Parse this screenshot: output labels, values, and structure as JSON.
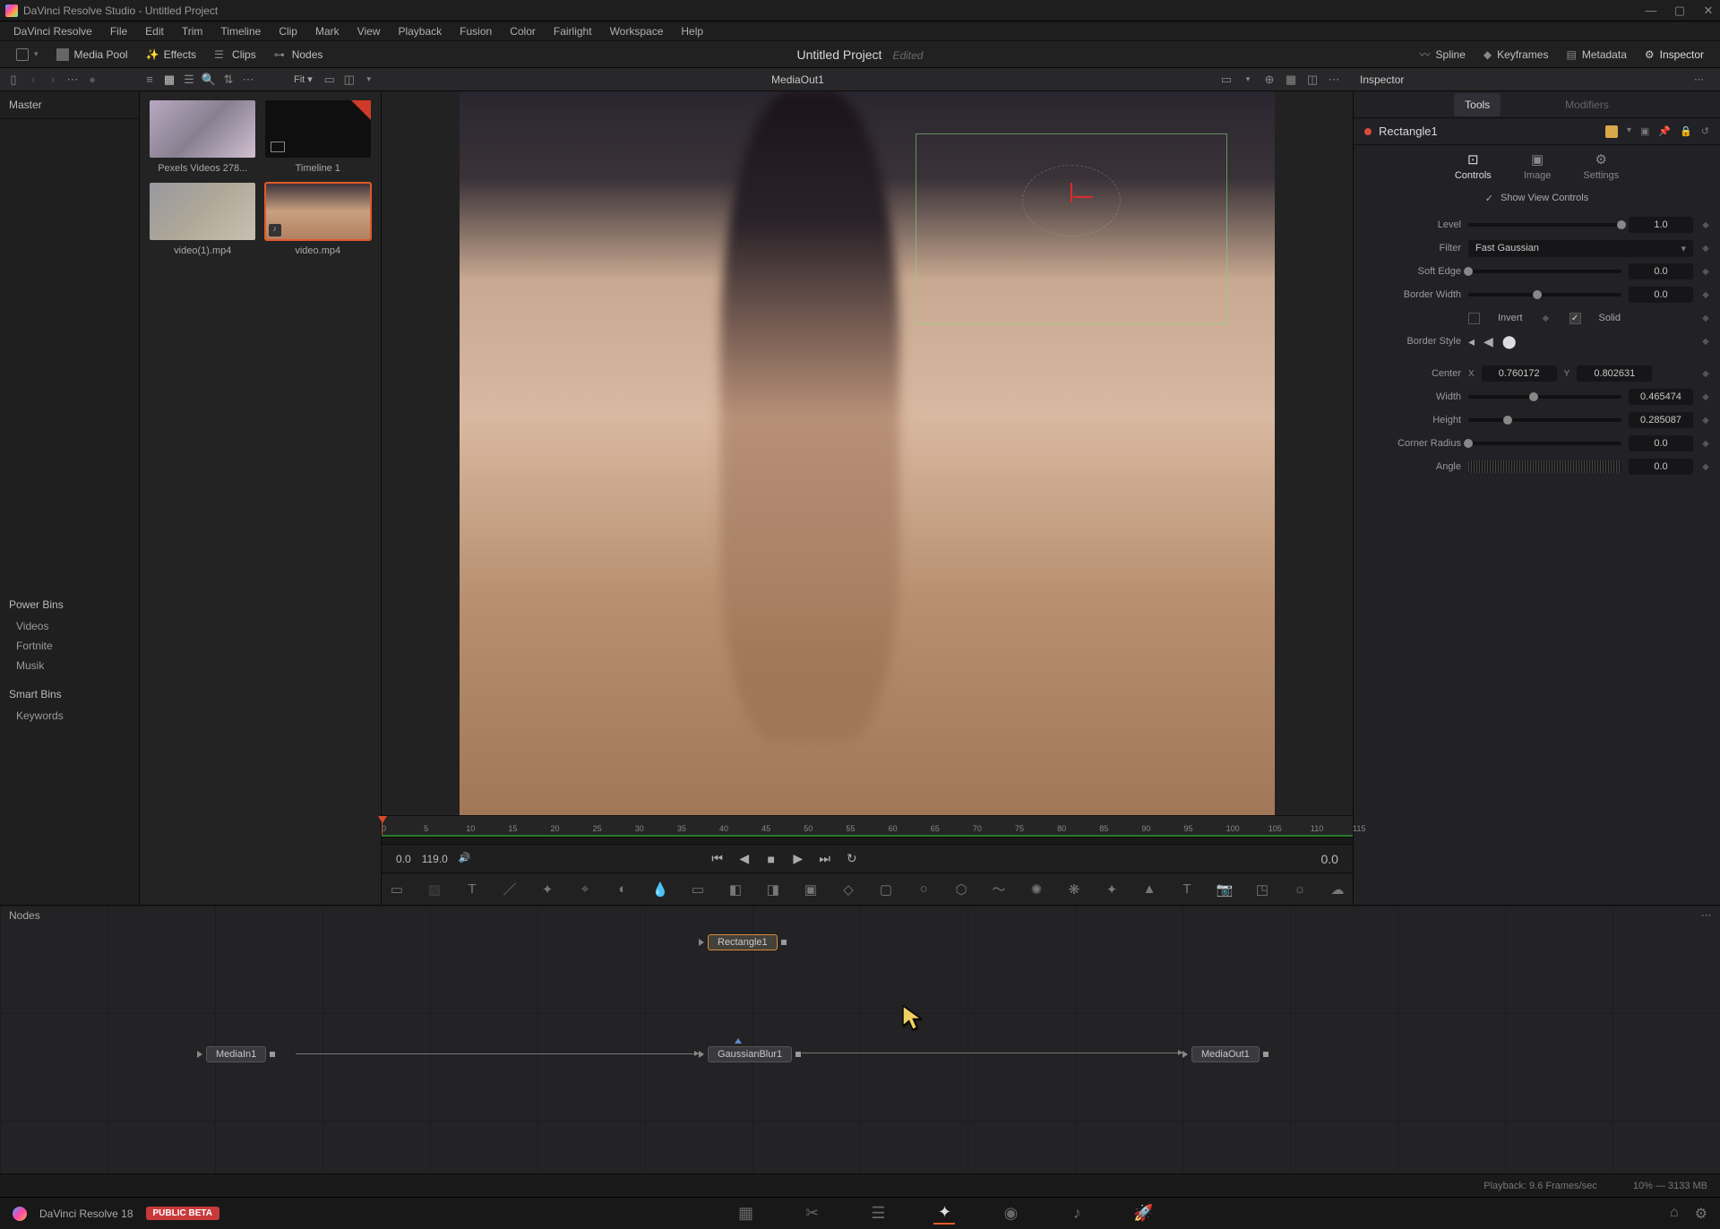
{
  "titlebar": {
    "text": "DaVinci Resolve Studio - Untitled Project"
  },
  "menu": [
    "DaVinci Resolve",
    "File",
    "Edit",
    "Trim",
    "Timeline",
    "Clip",
    "Mark",
    "View",
    "Playback",
    "Fusion",
    "Color",
    "Fairlight",
    "Workspace",
    "Help"
  ],
  "toolbar": {
    "media_pool": "Media Pool",
    "effects": "Effects",
    "clips": "Clips",
    "nodes": "Nodes",
    "project": "Untitled Project",
    "edited": "Edited",
    "spline": "Spline",
    "keyframes": "Keyframes",
    "metadata": "Metadata",
    "inspector": "Inspector"
  },
  "subtoolbar": {
    "fit": "Fit ▾",
    "media_out": "MediaOut1",
    "inspector": "Inspector"
  },
  "mediapanel": {
    "master": "Master",
    "powerbins": "Power Bins",
    "folders": [
      "Videos",
      "Fortnite",
      "Musik"
    ],
    "smartbins": "Smart Bins",
    "keywords": "Keywords"
  },
  "media_items": [
    {
      "label": "Pexels Videos 278...",
      "bg": "linear-gradient(135deg,#b8a8c0,#888090,#d0c0d0)"
    },
    {
      "label": "Timeline 1",
      "bg": "#0f0f0f",
      "timeline": true
    },
    {
      "label": "video(1).mp4",
      "bg": "linear-gradient(135deg,#9898a0,#b0a898,#c8c0b0)"
    },
    {
      "label": "video.mp4",
      "bg": "linear-gradient(180deg,#3a3038,#c8a080,#b08060)",
      "selected": true,
      "audio": true
    }
  ],
  "ruler_ticks": [
    "0",
    "5",
    "10",
    "15",
    "20",
    "25",
    "30",
    "35",
    "40",
    "45",
    "50",
    "55",
    "60",
    "65",
    "70",
    "75",
    "80",
    "85",
    "90",
    "95",
    "100",
    "105",
    "110",
    "115"
  ],
  "transport": {
    "start": "0.0",
    "end": "119.0",
    "current": "0.0"
  },
  "inspector": {
    "header": "Inspector",
    "tabs": [
      "Tools",
      "Modifiers"
    ],
    "node": "Rectangle1",
    "subtabs": [
      "Controls",
      "Image",
      "Settings"
    ],
    "show_view_controls": "Show View Controls",
    "props": {
      "level": {
        "label": "Level",
        "value": "1.0",
        "knob": 100
      },
      "filter": {
        "label": "Filter",
        "value": "Fast Gaussian"
      },
      "soft_edge": {
        "label": "Soft Edge",
        "value": "0.0",
        "knob": 0
      },
      "border_width": {
        "label": "Border Width",
        "value": "0.0",
        "knob": 42
      },
      "invert": {
        "label": "Invert"
      },
      "solid": {
        "label": "Solid"
      },
      "border_style": {
        "label": "Border Style"
      },
      "center": {
        "label": "Center",
        "x": "0.760172",
        "y": "0.802631"
      },
      "width": {
        "label": "Width",
        "value": "0.465474",
        "knob": 40
      },
      "height": {
        "label": "Height",
        "value": "0.285087",
        "knob": 23
      },
      "corner_radius": {
        "label": "Corner Radius",
        "value": "0.0",
        "knob": 0
      },
      "angle": {
        "label": "Angle",
        "value": "0.0"
      }
    }
  },
  "nodes": {
    "header": "Nodes",
    "items": {
      "rectangle": "Rectangle1",
      "mediain": "MediaIn1",
      "blur": "GaussianBlur1",
      "mediaout": "MediaOut1"
    }
  },
  "status": {
    "playback": "Playback: 9.6 Frames/sec",
    "mem": "10% — 3133 MB"
  },
  "pagebar": {
    "app": "DaVinci Resolve 18",
    "beta": "PUBLIC BETA"
  }
}
